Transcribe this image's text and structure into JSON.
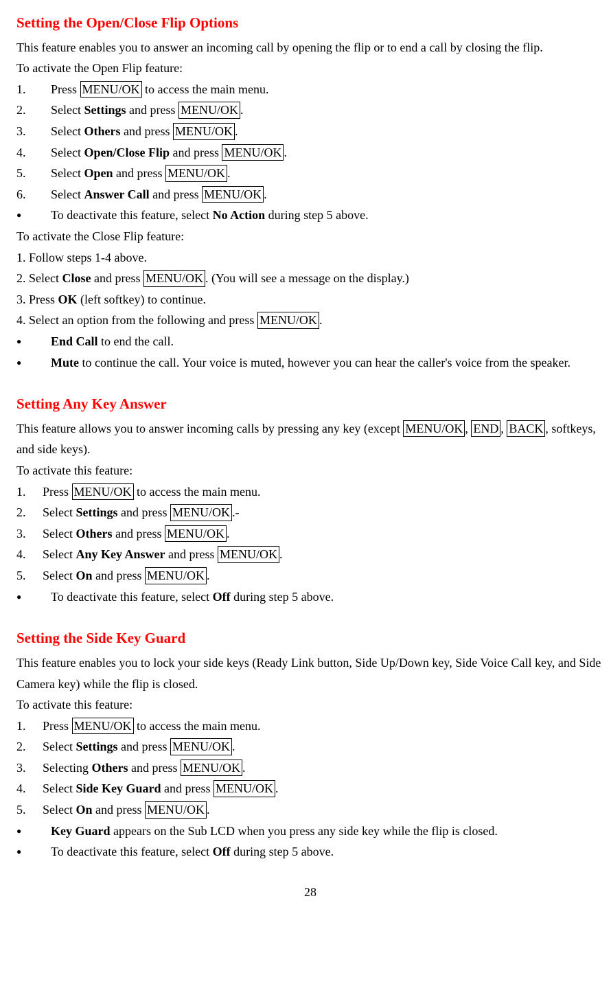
{
  "menuok": "MENU/OK",
  "endkey": "END",
  "backkey": "BACK",
  "s1": {
    "title": "Setting the Open/Close Flip Options",
    "intro": "This feature enables you to answer an incoming call by opening the flip or to end a call by closing the flip.",
    "act1": "To activate the Open Flip feature:",
    "i1_a": "Press ",
    "i1_b": " to access the main menu.",
    "i2_a": "Select ",
    "i2_b": "Settings",
    "i2_c": " and press ",
    "i2_d": ".",
    "i3_a": "Select ",
    "i3_b": "Others",
    "i3_c": " and press ",
    "i3_d": ".",
    "i4_a": "Select ",
    "i4_b": "Open/Close Flip",
    "i4_c": " and press ",
    "i4_d": ".",
    "i5_a": "Select ",
    "i5_b": "Open",
    "i5_c": " and press ",
    "i5_d": ".",
    "i6_a": "Select ",
    "i6_b": "Answer Call",
    "i6_c": " and press ",
    "i6_d": ".",
    "b1_a": "To deactivate this feature, select ",
    "b1_b": "No Action",
    "b1_c": " during step 5 above.",
    "act2": "To activate the Close Flip feature:",
    "c1": "1. Follow steps 1-4 above.",
    "c2_a": "2. Select ",
    "c2_b": "Close",
    "c2_c": " and press ",
    "c2_d": ". (You will see a message on the display.)",
    "c3_a": "3. Press ",
    "c3_b": "OK",
    "c3_c": " (left softkey) to continue.",
    "c4_a": "4. Select an option from the following and press ",
    "c4_b": ".",
    "d1_a": "End Call",
    "d1_b": " to end the call.",
    "d2_a": "Mute",
    "d2_b": " to continue the call. Your voice is muted, however you can hear the caller's voice from the speaker."
  },
  "s2": {
    "title": "Setting Any Key Answer",
    "intro_a": "This feature allows you to answer incoming calls by pressing any key (except ",
    "intro_b": ", ",
    "intro_c": ", ",
    "intro_d": ", softkeys, and side keys).",
    "act": "To activate this feature:",
    "i1_a": "Press ",
    "i1_b": " to access the main menu.",
    "i2_a": "Select ",
    "i2_b": "Settings",
    "i2_c": " and press ",
    "i2_d": ".-",
    "i3_a": "Select ",
    "i3_b": "Others",
    "i3_c": " and press ",
    "i3_d": ".",
    "i4_a": "Select ",
    "i4_b": "Any Key Answer",
    "i4_c": " and press ",
    "i4_d": ".",
    "i5_a": "Select ",
    "i5_b": "On",
    "i5_c": " and press ",
    "i5_d": ".",
    "b1_a": "To deactivate this feature, select ",
    "b1_b": "Off",
    "b1_c": " during step 5 above."
  },
  "s3": {
    "title": "Setting the Side Key Guard",
    "intro": "This feature enables you to lock your side keys (Ready Link button, Side Up/Down key, Side Voice Call key, and Side Camera key) while the flip is closed.",
    "act": "To activate this feature:",
    "i1_a": "Press ",
    "i1_b": " to access the main menu.",
    "i2_a": "Select ",
    "i2_b": "Settings",
    "i2_c": " and press ",
    "i2_d": ".",
    "i3_a": "Selecting ",
    "i3_b": "Others",
    "i3_c": " and press ",
    "i3_d": ".",
    "i4_a": "Select ",
    "i4_b": "Side Key Guard",
    "i4_c": " and press ",
    "i4_d": ".",
    "i5_a": "Select ",
    "i5_b": "On",
    "i5_c": " and press ",
    "i5_d": ".",
    "b1_a": "Key Guard",
    "b1_b": " appears on the Sub LCD when you press any side key while the flip is closed.",
    "b2_a": "To deactivate this feature, select ",
    "b2_b": "Off",
    "b2_c": " during step 5 above."
  },
  "page": "28",
  "nums": {
    "n1": "1.",
    "n2": "2.",
    "n3": "3.",
    "n4": "4.",
    "n5": "5.",
    "n6": "6."
  }
}
